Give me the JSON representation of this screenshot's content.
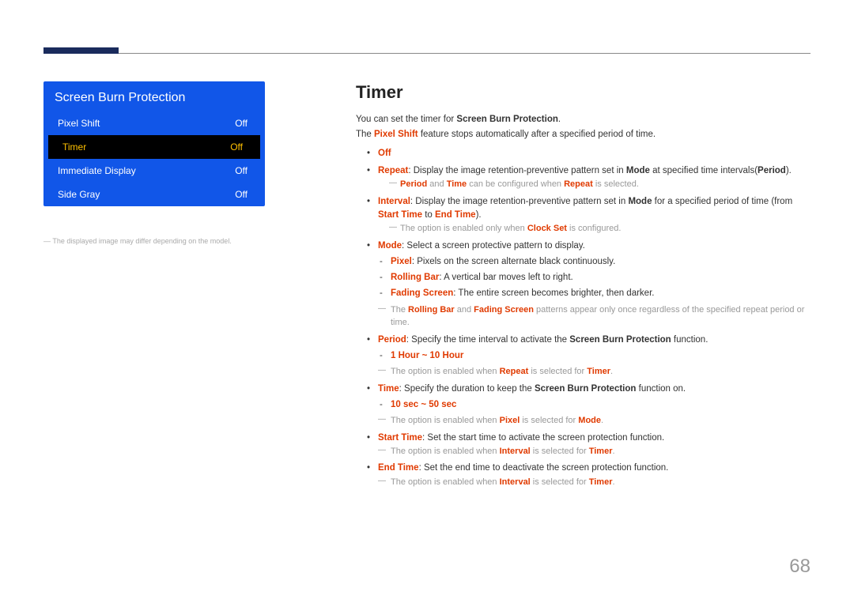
{
  "menu": {
    "title": "Screen Burn Protection",
    "items": [
      {
        "label": "Pixel Shift",
        "value": "Off",
        "selected": false
      },
      {
        "label": "Timer",
        "value": "Off",
        "selected": true
      },
      {
        "label": "Immediate Display",
        "value": "Off",
        "selected": false
      },
      {
        "label": "Side Gray",
        "value": "Off",
        "selected": false
      }
    ],
    "footnote": "― The displayed image may differ depending on the model."
  },
  "heading": "Timer",
  "intro1_a": "You can set the timer for ",
  "intro1_b": "Screen Burn Protection",
  "intro1_c": ".",
  "intro2_a": "The ",
  "intro2_b": "Pixel Shift",
  "intro2_c": " feature stops automatically after a specified period of time.",
  "b_off": "Off",
  "b_repeat_a": "Repeat",
  "b_repeat_b": ": Display the image retention-preventive pattern set in ",
  "b_repeat_c": "Mode",
  "b_repeat_d": " at specified time intervals(",
  "b_repeat_e": "Period",
  "b_repeat_f": ").",
  "n_repeat_a": "Period",
  "n_repeat_b": " and ",
  "n_repeat_c": "Time",
  "n_repeat_d": " can be configured when ",
  "n_repeat_e": "Repeat",
  "n_repeat_f": " is selected.",
  "b_int_a": "Interval",
  "b_int_b": ": Display the image retention-preventive pattern set in ",
  "b_int_c": "Mode",
  "b_int_d": " for a specified period of time (from ",
  "b_int_e": "Start Time",
  "b_int_f": " to ",
  "b_int_g": "End Time",
  "b_int_h": ").",
  "n_int_a": "The option is enabled only when ",
  "n_int_b": "Clock Set",
  "n_int_c": " is configured.",
  "b_mode_a": "Mode",
  "b_mode_b": ": Select a screen protective pattern to display.",
  "s_pixel_a": "Pixel",
  "s_pixel_b": ": Pixels on the screen alternate black continuously.",
  "s_roll_a": "Rolling Bar",
  "s_roll_b": ": A vertical bar moves left to right.",
  "s_fade_a": "Fading Screen",
  "s_fade_b": ": The entire screen becomes brighter, then darker.",
  "sn_mode_a": "The ",
  "sn_mode_b": "Rolling Bar",
  "sn_mode_c": " and ",
  "sn_mode_d": "Fading Screen",
  "sn_mode_e": " patterns appear only once regardless of the specified repeat period or time.",
  "b_per_a": "Period",
  "b_per_b": ": Specify the time interval to activate the ",
  "b_per_c": "Screen Burn Protection",
  "b_per_d": " function.",
  "s_per": "1 Hour ~ 10 Hour",
  "sn_per_a": "The option is enabled when ",
  "sn_per_b": "Repeat",
  "sn_per_c": " is selected for ",
  "sn_per_d": "Timer",
  "sn_per_e": ".",
  "b_time_a": "Time",
  "b_time_b": ": Specify the duration to keep the ",
  "b_time_c": "Screen Burn Protection",
  "b_time_d": " function on.",
  "s_time": "10 sec ~ 50 sec",
  "sn_time_a": "The option is enabled when ",
  "sn_time_b": "Pixel",
  "sn_time_c": " is selected for ",
  "sn_time_d": "Mode",
  "sn_time_e": ".",
  "b_start_a": "Start Time",
  "b_start_b": ": Set the start time to activate the screen protection function.",
  "sn_start_a": "The option is enabled when ",
  "sn_start_b": "Interval",
  "sn_start_c": " is selected for ",
  "sn_start_d": "Timer",
  "sn_start_e": ".",
  "b_end_a": "End Time",
  "b_end_b": ": Set the end time to deactivate the screen protection function.",
  "sn_end_a": "The option is enabled when ",
  "sn_end_b": "Interval",
  "sn_end_c": " is selected for ",
  "sn_end_d": "Timer",
  "sn_end_e": ".",
  "page_number": "68"
}
